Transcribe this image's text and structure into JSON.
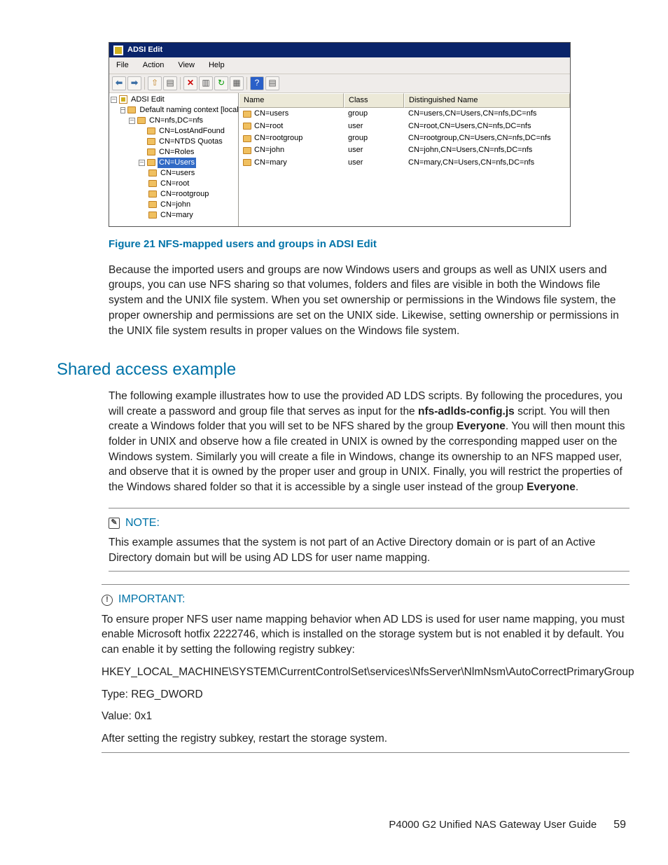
{
  "screenshot": {
    "title": "ADSI Edit",
    "menu": [
      "File",
      "Action",
      "View",
      "Help"
    ],
    "tree": {
      "root": "ADSI Edit",
      "ctx": "Default naming context [localhost",
      "n1": "CN=nfs,DC=nfs",
      "n2": "CN=LostAndFound",
      "n3": "CN=NTDS Quotas",
      "n4": "CN=Roles",
      "n5": "CN=Users",
      "c1": "CN=users",
      "c2": "CN=root",
      "c3": "CN=rootgroup",
      "c4": "CN=john",
      "c5": "CN=mary"
    },
    "columns": {
      "name": "Name",
      "class": "Class",
      "dn": "Distinguished Name"
    },
    "rows": [
      {
        "name": "CN=users",
        "class": "group",
        "dn": "CN=users,CN=Users,CN=nfs,DC=nfs"
      },
      {
        "name": "CN=root",
        "class": "user",
        "dn": "CN=root,CN=Users,CN=nfs,DC=nfs"
      },
      {
        "name": "CN=rootgroup",
        "class": "group",
        "dn": "CN=rootgroup,CN=Users,CN=nfs,DC=nfs"
      },
      {
        "name": "CN=john",
        "class": "user",
        "dn": "CN=john,CN=Users,CN=nfs,DC=nfs"
      },
      {
        "name": "CN=mary",
        "class": "user",
        "dn": "CN=mary,CN=Users,CN=nfs,DC=nfs"
      }
    ]
  },
  "caption": "Figure 21 NFS-mapped users and groups in ADSI Edit",
  "para1a": "Because the imported users and groups are now Windows users and groups as well as UNIX users and groups, you can use NFS sharing so that volumes, folders and files are visible in both the Windows file system and the UNIX file system. When you set ownership or permissions in the Windows file system, the proper ownership and permissions are set on the UNIX side. Likewise, setting ownership or permissions in the UNIX file system results in proper values on the Windows file system.",
  "h2": "Shared access example",
  "para2a": "The following example illustrates how to use the provided AD LDS scripts. By following the procedures, you will create a password and group file that serves as input for the ",
  "para2b": "nfs-adlds-config.js",
  "para2c": " script. You will then create a Windows folder that you will set to be NFS shared by the group ",
  "para2d": "Everyone",
  "para2e": ". You will then mount this folder in UNIX and observe how a file created in UNIX is owned by the corresponding mapped user on the Windows system. Similarly you will create a file in Windows, change its ownership to an NFS mapped user, and observe that it is owned by the proper user and group in UNIX. Finally, you will restrict the properties of the Windows shared folder so that it is accessible by a single user instead of the group ",
  "para2f": "Everyone",
  "para2g": ".",
  "note": {
    "head": "NOTE:",
    "body": "This example assumes that the system is not part of an Active Directory domain or is part of an Active Directory domain but will be using AD LDS for user name mapping."
  },
  "important": {
    "head": "IMPORTANT:",
    "p1": "To ensure proper NFS user name mapping behavior when AD LDS is used for user name mapping, you must enable Microsoft hotfix 2222746, which is installed on the storage system but is not enabled it by default. You can enable it by setting the following registry subkey:",
    "p2": "HKEY_LOCAL_MACHINE\\SYSTEM\\CurrentControlSet\\services\\NfsServer\\NlmNsm\\AutoCorrectPrimaryGroup",
    "p3": "Type: REG_DWORD",
    "p4": "Value: 0x1",
    "p5": "After setting the registry subkey, restart the storage system."
  },
  "footer": {
    "title": "P4000 G2 Unified NAS Gateway User Guide",
    "page": "59"
  }
}
